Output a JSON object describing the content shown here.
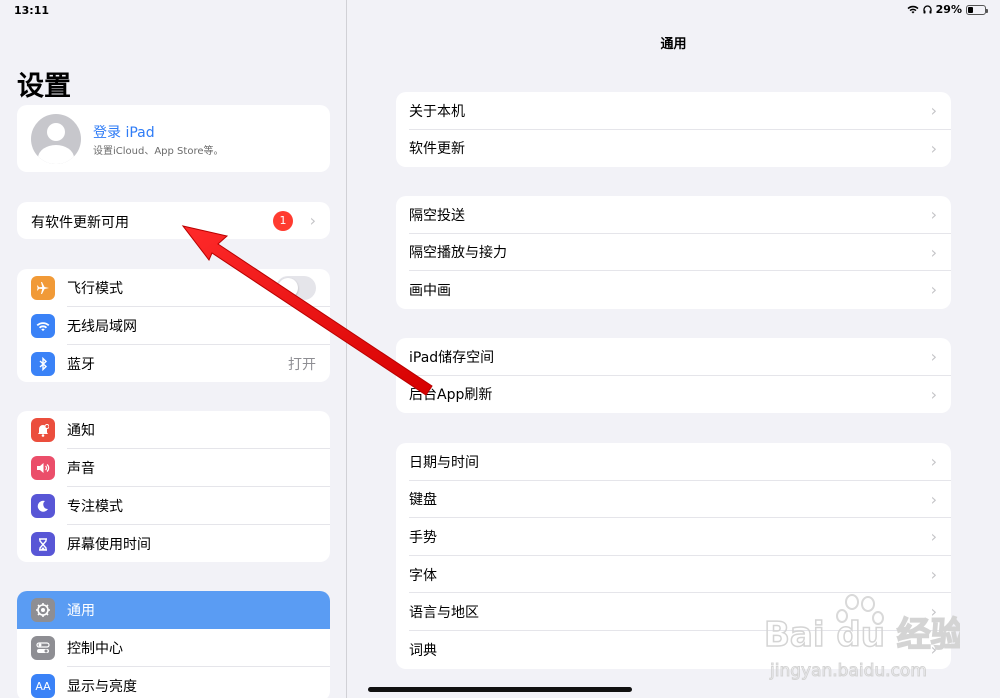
{
  "status": {
    "time": "13:11",
    "battery": "29%",
    "battery_level": 0.29
  },
  "sidebar": {
    "title": "设置",
    "profile": {
      "name": "登录 iPad",
      "subtitle": "设置iCloud、App Store等。"
    },
    "update": {
      "label": "有软件更新可用",
      "badge": "1"
    },
    "group1": [
      {
        "label": "飞行模式",
        "icon": "airplane-icon",
        "color": "#f19a37",
        "toggle": false
      },
      {
        "label": "无线局域网",
        "icon": "wifi-icon",
        "color": "#3a82f7",
        "value": ""
      },
      {
        "label": "蓝牙",
        "icon": "bluetooth-icon",
        "color": "#3a82f7",
        "value": "打开"
      }
    ],
    "group2": [
      {
        "label": "通知",
        "icon": "bell-icon",
        "color": "#eb4e3d"
      },
      {
        "label": "声音",
        "icon": "speaker-icon",
        "color": "#eb4e6a"
      },
      {
        "label": "专注模式",
        "icon": "moon-icon",
        "color": "#5856d6"
      },
      {
        "label": "屏幕使用时间",
        "icon": "hourglass-icon",
        "color": "#5856d6"
      }
    ],
    "group3": [
      {
        "label": "通用",
        "icon": "gear-icon",
        "color": "#8e8e93",
        "selected": true
      },
      {
        "label": "控制中心",
        "icon": "toggles-icon",
        "color": "#8e8e93"
      },
      {
        "label": "显示与亮度",
        "icon": "text-size-icon",
        "color": "#3a82f7"
      }
    ]
  },
  "main": {
    "title": "通用",
    "groups": [
      [
        "关于本机",
        "软件更新"
      ],
      [
        "隔空投送",
        "隔空播放与接力",
        "画中画"
      ],
      [
        "iPad储存空间",
        "后台App刷新"
      ],
      [
        "日期与时间",
        "键盘",
        "手势",
        "字体",
        "语言与地区",
        "词典"
      ]
    ]
  },
  "watermark": {
    "brand": "Bai du 经验",
    "url": "jingyan.baidu.com"
  }
}
